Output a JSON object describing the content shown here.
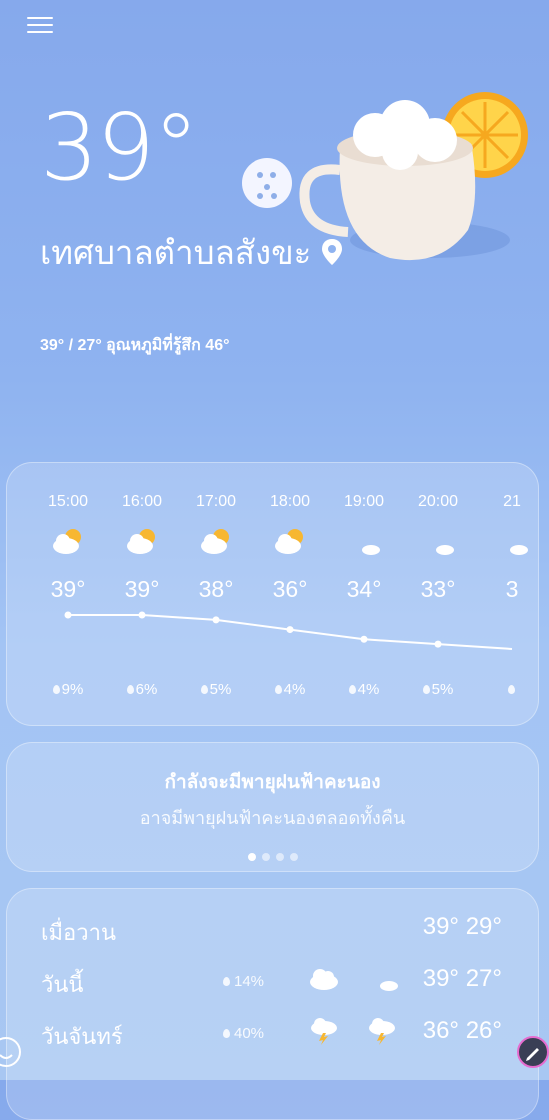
{
  "header": {
    "menu_icon": "hamburger-menu-icon"
  },
  "current": {
    "temperature": "39°",
    "location": "เทศบาลตำบลสังขะ",
    "location_icon": "location-pin-icon",
    "summary": "39° / 27° อุณหภูมิที่รู้สึก 46°"
  },
  "hourly": {
    "items": [
      {
        "time": "15:00",
        "icon": "partly-cloudy-day-icon",
        "temp": "39°",
        "precip": "9%"
      },
      {
        "time": "16:00",
        "icon": "partly-cloudy-day-icon",
        "temp": "39°",
        "precip": "6%"
      },
      {
        "time": "17:00",
        "icon": "partly-cloudy-day-icon",
        "temp": "38°",
        "precip": "5%"
      },
      {
        "time": "18:00",
        "icon": "partly-cloudy-day-icon",
        "temp": "36°",
        "precip": "4%"
      },
      {
        "time": "19:00",
        "icon": "partly-cloudy-night-icon",
        "temp": "34°",
        "precip": "4%"
      },
      {
        "time": "20:00",
        "icon": "partly-cloudy-night-icon",
        "temp": "33°",
        "precip": "5%"
      },
      {
        "time": "21",
        "icon": "partly-cloudy-night-icon",
        "temp": "3",
        "precip": ""
      }
    ],
    "temps_numeric": [
      39,
      39,
      38,
      36,
      34,
      33,
      32
    ]
  },
  "alert": {
    "title": "กำลังจะมีพายุฝนฟ้าคะนอง",
    "subtitle": "อาจมีพายุฝนฟ้าคะนองตลอดทั้งคืน",
    "page_count": 4,
    "active_page": 1
  },
  "daily": [
    {
      "name": "เมื่อวาน",
      "precip": "",
      "icon_day": "",
      "icon_night": "",
      "temps": "39° 29°"
    },
    {
      "name": "วันนี้",
      "precip": "14%",
      "icon_day": "cloudy-icon",
      "icon_night": "partly-cloudy-night-icon",
      "temps": "39° 27°"
    },
    {
      "name": "วันจันทร์",
      "precip": "40%",
      "icon_day": "thunderstorm-icon",
      "icon_night": "thunderstorm-icon",
      "temps": "36° 26°"
    }
  ],
  "colors": {
    "accent": "#ffffff",
    "sun": "#f7b731",
    "background_top": "#86a9ec"
  }
}
